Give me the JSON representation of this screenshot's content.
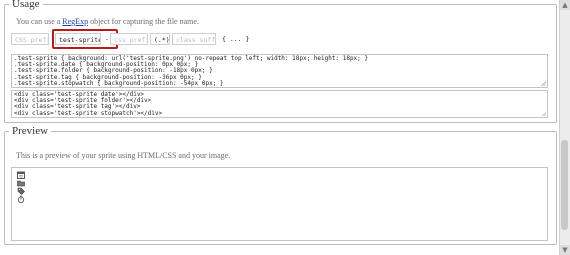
{
  "usage": {
    "legend": "Usage",
    "description_before": "You can use a ",
    "description_link": "RegExp",
    "description_after": " object for capturing the file name.",
    "pattern": {
      "css_prefix_placeholder": "CSS prefix",
      "class_value": "test-sprite",
      "css_separator": "-",
      "css_prefix2_placeholder": "css prefix",
      "capture_group": "(.*)",
      "class_suffix_placeholder": "class suffix",
      "block_label": "{ ... }"
    },
    "css_lines": [
      ".test-sprite { background: url('test-sprite.png') no-repeat top left; width: 18px; height: 18px; }",
      ".test-sprite.date { background-position: 0px 0px; }",
      ".test-sprite.folder { background-position: -18px 0px; }",
      ".test-sprite.tag { background-position: -36px 0px; }",
      ".test-sprite.stopwatch { background-position: -54px 0px; }"
    ],
    "html_lines": [
      "<div class='test-sprite date'></div>",
      "<div class='test-sprite folder'></div>",
      "<div class='test-sprite tag'></div>",
      "<div class='test-sprite stopwatch'></div>"
    ]
  },
  "preview": {
    "legend": "Preview",
    "description": "This is a preview of your sprite using HTML/CSS and your image.",
    "sprites": [
      "calendar-icon",
      "folder-icon",
      "tag-icon",
      "stopwatch-icon"
    ]
  },
  "scrollbar": {
    "up_arrow": "▲",
    "down_arrow": "▼"
  }
}
